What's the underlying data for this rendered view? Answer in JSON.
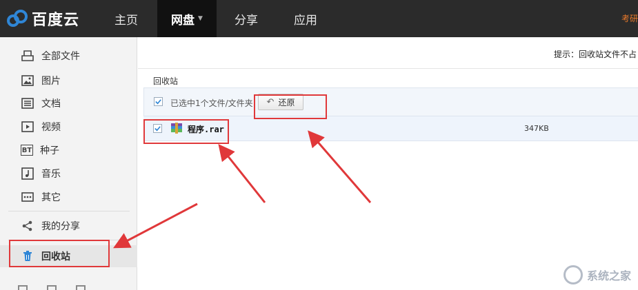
{
  "app": {
    "logo_text": "百度云",
    "nav": [
      {
        "label": "主页"
      },
      {
        "label": "网盘"
      },
      {
        "label": "分享"
      },
      {
        "label": "应用"
      }
    ],
    "top_right_text": "考研"
  },
  "sidebar": {
    "items": [
      {
        "label": "全部文件",
        "icon": "all-files-icon"
      },
      {
        "label": "图片",
        "icon": "image-icon"
      },
      {
        "label": "文档",
        "icon": "document-icon"
      },
      {
        "label": "视频",
        "icon": "video-icon"
      },
      {
        "label": "种子",
        "icon": "bt-icon",
        "icon_text": "BT"
      },
      {
        "label": "音乐",
        "icon": "music-icon"
      },
      {
        "label": "其它",
        "icon": "other-icon"
      },
      {
        "label": "我的分享",
        "icon": "share-icon"
      },
      {
        "label": "回收站",
        "icon": "trash-icon"
      }
    ]
  },
  "main": {
    "tip": "提示：回收站文件不占",
    "breadcrumb": "回收站",
    "selection_text": "已选中1个文件/文件夹",
    "restore_label": "还原",
    "files": [
      {
        "name": "程序.rar",
        "size": "347KB",
        "checked": true
      }
    ]
  },
  "watermark": "系统之家",
  "colors": {
    "topbar": "#2b2b2b",
    "annotation": "#e0383a",
    "accent": "#2f86d6"
  }
}
